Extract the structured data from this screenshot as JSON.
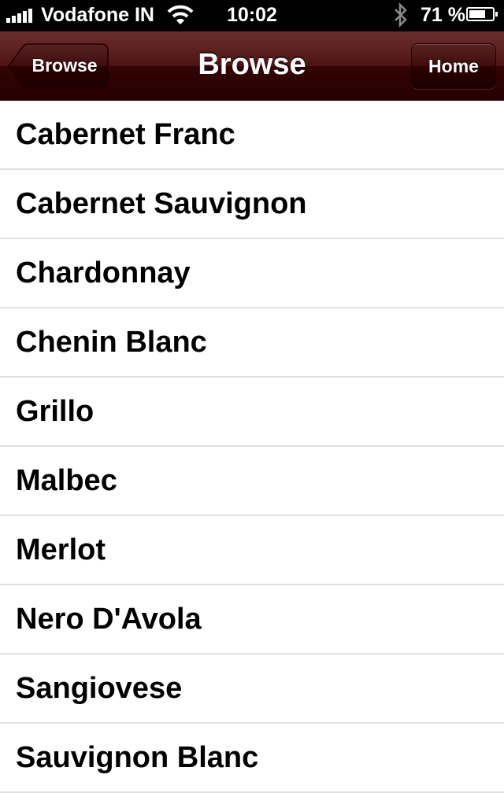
{
  "status_bar": {
    "carrier": "Vodafone IN",
    "time": "10:02",
    "battery_percent_label": "71 %",
    "battery_level": 0.71,
    "icons": [
      "signal-icon",
      "wifi-icon",
      "bluetooth-icon",
      "battery-icon"
    ]
  },
  "nav": {
    "title": "Browse",
    "back_label": "Browse",
    "home_label": "Home",
    "color": "#4e1414"
  },
  "list": {
    "items": [
      "Cabernet Franc",
      "Cabernet Sauvignon",
      "Chardonnay",
      "Chenin Blanc",
      "Grillo",
      "Malbec",
      "Merlot",
      "Nero D'Avola",
      "Sangiovese",
      "Sauvignon Blanc"
    ]
  }
}
